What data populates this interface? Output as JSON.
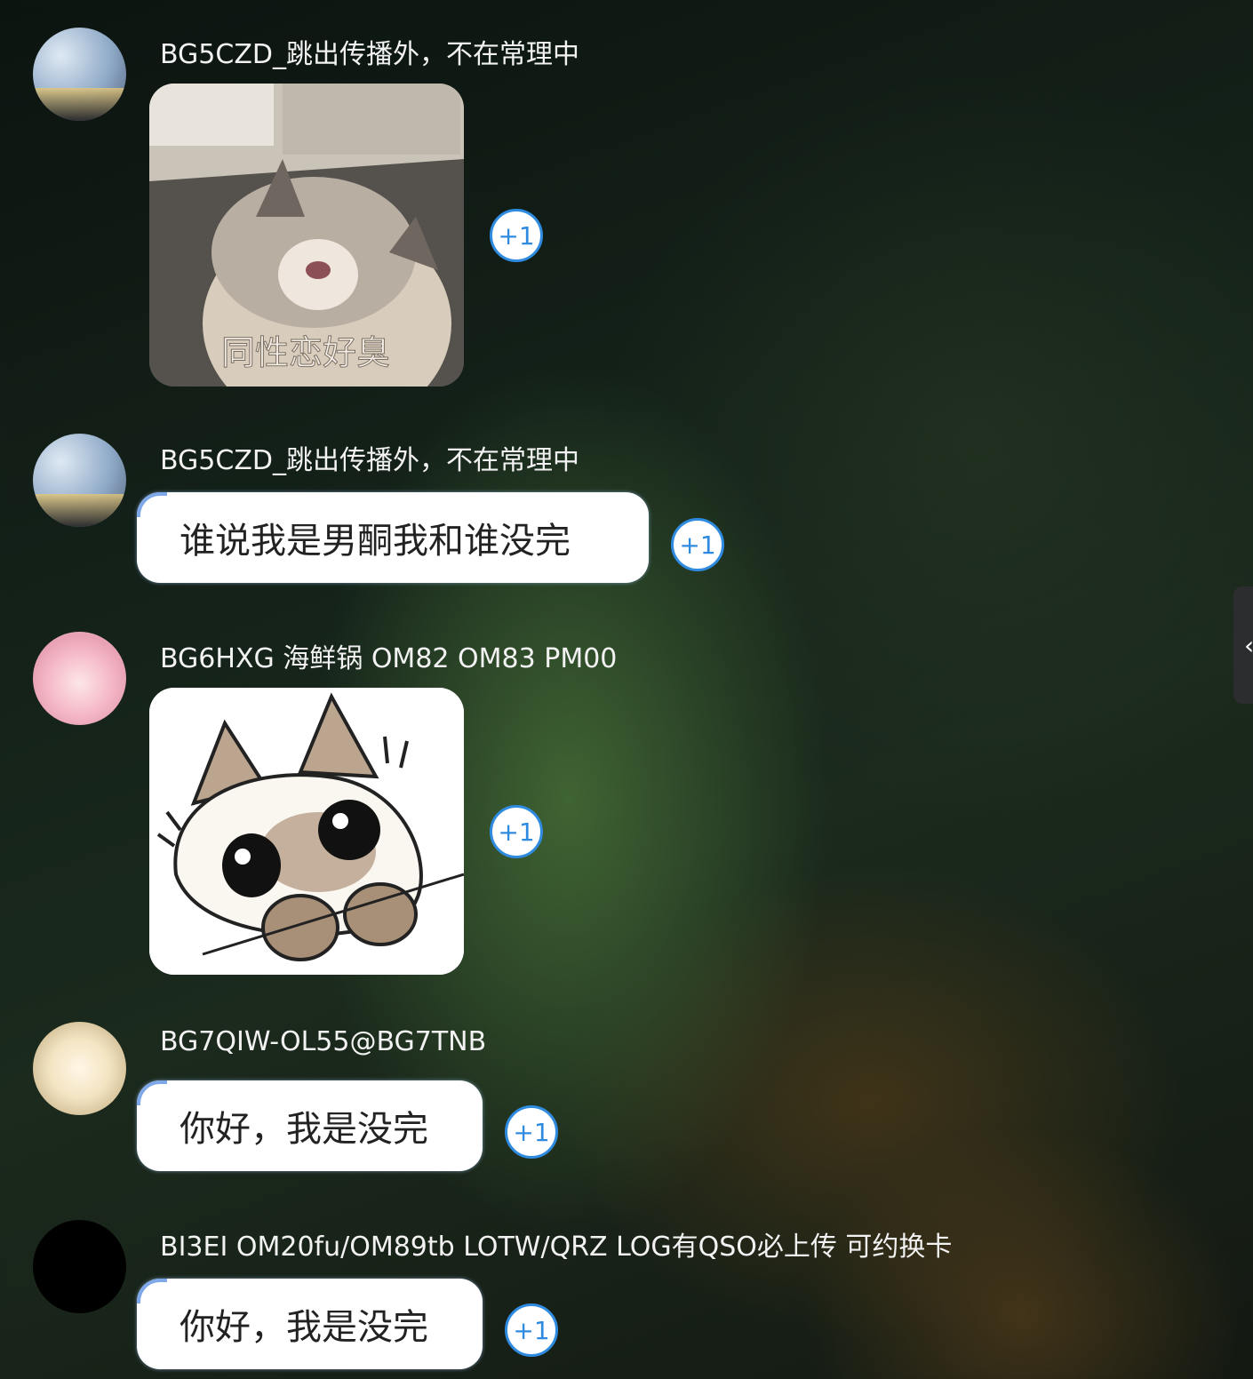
{
  "messages": [
    {
      "sender": "BG5CZD_跳出传播外，不在常理中",
      "type": "sticker",
      "caption": "同性恋好臭",
      "plus": "+1"
    },
    {
      "sender": "BG5CZD_跳出传播外，不在常理中",
      "type": "text",
      "text": "谁说我是男酮我和谁没完",
      "plus": "+1"
    },
    {
      "sender": "BG6HXG 海鲜锅 OM82 OM83 PM00",
      "type": "sticker",
      "caption": "",
      "plus": "+1"
    },
    {
      "sender": "BG7QIW-OL55@BG7TNB",
      "type": "text",
      "text": "你好，我是没完",
      "plus": "+1"
    },
    {
      "sender": "BI3EI OM20fu/OM89tb LOTW/QRZ LOG有QSO必上传 可约换卡",
      "type": "text",
      "text": "你好，我是没完",
      "plus": "+1"
    }
  ],
  "side_tab": {
    "icon": "chevron-left-icon",
    "glyph": "‹"
  }
}
